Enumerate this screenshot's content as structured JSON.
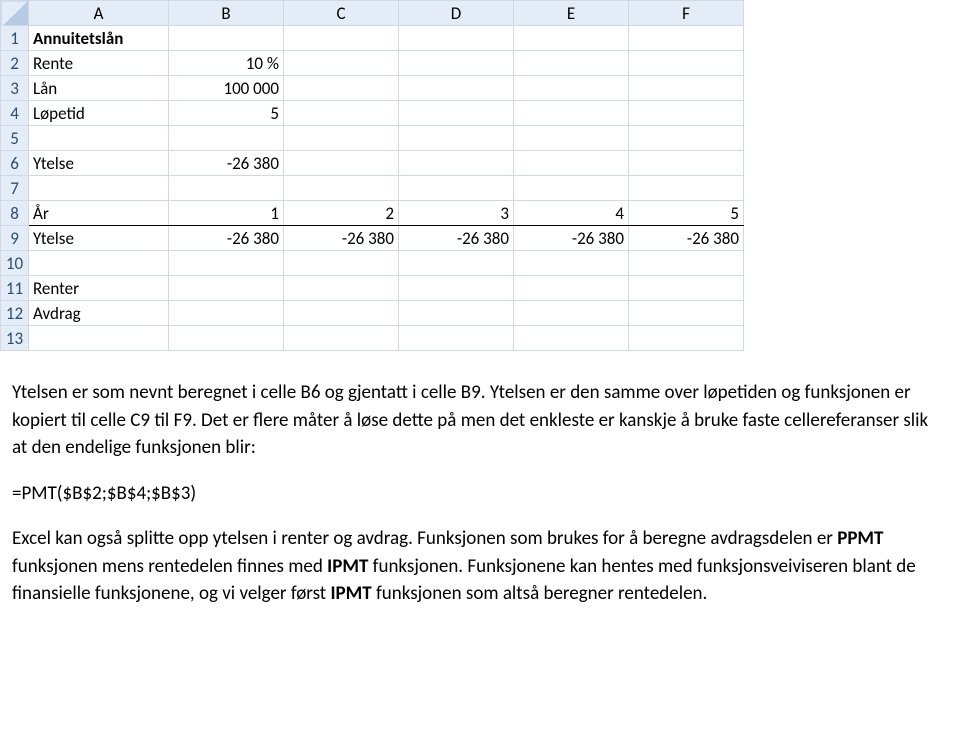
{
  "sheet": {
    "columns": [
      "A",
      "B",
      "C",
      "D",
      "E",
      "F"
    ],
    "row_numbers": [
      "1",
      "2",
      "3",
      "4",
      "5",
      "6",
      "7",
      "8",
      "9",
      "10",
      "11",
      "12",
      "13"
    ],
    "cells": {
      "A1": "Annuitetslån",
      "A2": "Rente",
      "B2": "10 %",
      "A3": "Lån",
      "B3": "100 000",
      "A4": "Løpetid",
      "B4": "5",
      "A6": "Ytelse",
      "B6": "-26 380",
      "A8": "År",
      "B8": "1",
      "C8": "2",
      "D8": "3",
      "E8": "4",
      "F8": "5",
      "A9": "Ytelse",
      "B9": "-26 380",
      "C9": "-26 380",
      "D9": "-26 380",
      "E9": "-26 380",
      "F9": "-26 380",
      "A11": "Renter",
      "A12": "Avdrag"
    }
  },
  "body": {
    "p1_part1": "Ytelsen er som nevnt beregnet i celle B6 og gjentatt i celle B9. Ytelsen er den samme over løpetiden og funksjonen er kopiert til celle C9 til F9. Det er flere måter å løse dette på men det enkleste er kanskje å bruke faste cellereferanser slik at den endelige funksjonen blir:",
    "formula": "=PMT($B$2;$B$4;$B$3)",
    "p2_part1": "Excel kan også splitte opp ytelsen i renter og avdrag. Funksjonen som brukes for å beregne avdragsdelen er ",
    "p2_ppmt": "PPMT",
    "p2_part2": " funksjonen mens rentedelen finnes med ",
    "p2_ipmt": "IPMT",
    "p2_part3": " funksjonen. Funksjonene kan hentes med funksjonsveiviseren blant de finansielle funksjonene, og vi velger først ",
    "p2_ipmt2": "IPMT",
    "p2_part4": " funksjonen som altså beregner rentedelen."
  }
}
